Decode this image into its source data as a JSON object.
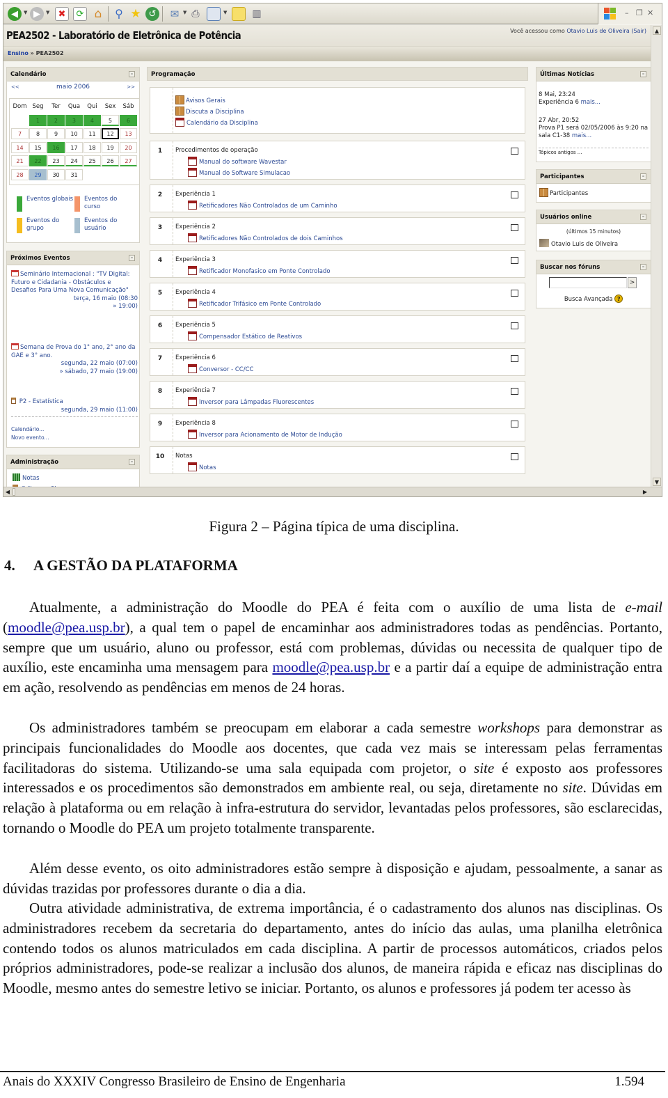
{
  "browser": {
    "toolbar_icons": [
      "back-icon",
      "forward-icon",
      "stop-icon",
      "refresh-icon",
      "home-icon",
      "search-icon",
      "favorites-icon",
      "history-icon",
      "mail-icon",
      "print-icon",
      "edit-icon",
      "notes-icon",
      "research-icon"
    ],
    "window_controls": [
      "minimize",
      "restore",
      "close"
    ]
  },
  "moodle": {
    "site_title": "PEA2502 - Laboratório de Eletrônica de Potência",
    "login": {
      "prefix": "Você acessou como",
      "user": "Otavio Luis de Oliveira",
      "logout": "(Sair)"
    },
    "breadcrumb": {
      "root": "Ensino",
      "sep": "»",
      "current": "PEA2502"
    },
    "calendar": {
      "title": "Calendário",
      "prev": "<<",
      "month": "maio 2006",
      "next": ">>",
      "weekdays": [
        "Dom",
        "Seg",
        "Ter",
        "Qua",
        "Qui",
        "Sex",
        "Sáb"
      ],
      "weeks": [
        [
          "",
          "1",
          "2",
          "3",
          "4",
          "5",
          "6"
        ],
        [
          "7",
          "8",
          "9",
          "10",
          "11",
          "12",
          "13"
        ],
        [
          "14",
          "15",
          "16",
          "17",
          "18",
          "19",
          "20"
        ],
        [
          "21",
          "22",
          "23",
          "24",
          "25",
          "26",
          "27"
        ],
        [
          "28",
          "29",
          "30",
          "31",
          "",
          "",
          ""
        ]
      ],
      "today": "12",
      "global_event_days": [
        "1",
        "2",
        "3",
        "4",
        "6",
        "16",
        "22"
      ],
      "underlined_days": [
        "5",
        "23",
        "24",
        "25",
        "26",
        "27"
      ],
      "user_event_days": [
        "29"
      ],
      "legend": [
        {
          "label": "Eventos globais",
          "color": "#3aa83a"
        },
        {
          "label": "Eventos do curso",
          "color": "#f4956a"
        },
        {
          "label": "Eventos do grupo",
          "color": "#f5bd1f"
        },
        {
          "label": "Eventos do usuário",
          "color": "#a7bfcf"
        }
      ]
    },
    "upcoming": {
      "title": "Próximos Eventos",
      "events": [
        {
          "name": "Seminário Internacional : \"TV Digital: Futuro e Cidadania - Obstáculos e Desafios Para Uma Nova Comunicação\"",
          "start": "terça, 16 maio (08:30",
          "end": "» 19:00)"
        },
        {
          "name": "Semana de Prova do 1° ano, 2° ano da GAE e 3° ano.",
          "start": "segunda, 22 maio (07:00)",
          "end": "» sábado, 27 maio (19:00)"
        },
        {
          "name": "P2 - Estatística",
          "start": "segunda, 29 maio (11:00)",
          "end": ""
        }
      ],
      "links": [
        "Calendário...",
        "Novo evento..."
      ]
    },
    "admin": {
      "title": "Administração",
      "items": [
        "Notas",
        "Editar perfil"
      ]
    },
    "programacao": {
      "title": "Programação",
      "intro": [
        {
          "icon": "forum",
          "label": "Avisos Gerais"
        },
        {
          "icon": "forum",
          "label": "Discuta a Disciplina"
        },
        {
          "icon": "pdf",
          "label": "Calendário da Disciplina"
        }
      ],
      "sections": [
        {
          "num": "1",
          "title": "Procedimentos de operação",
          "resources": [
            "Manual do software Wavestar",
            "Manual do Software Simulacao"
          ]
        },
        {
          "num": "2",
          "title": "Experiência 1",
          "resources": [
            "Retificadores Não Controlados de um Caminho"
          ]
        },
        {
          "num": "3",
          "title": "Experiência 2",
          "resources": [
            "Retificadores Não Controlados de dois Caminhos"
          ]
        },
        {
          "num": "4",
          "title": "Experiência 3",
          "resources": [
            "Retificador Monofasico em Ponte Controlado"
          ]
        },
        {
          "num": "5",
          "title": "Experiência 4",
          "resources": [
            "Retificador Trifásico em Ponte Controlado"
          ]
        },
        {
          "num": "6",
          "title": "Experiência 5",
          "resources": [
            "Compensador Estático de Reativos"
          ]
        },
        {
          "num": "7",
          "title": "Experiência 6",
          "resources": [
            "Conversor - CC/CC"
          ]
        },
        {
          "num": "8",
          "title": "Experiência 7",
          "resources": [
            "Inversor para Lâmpadas Fluorescentes"
          ]
        },
        {
          "num": "9",
          "title": "Experiência 8",
          "resources": [
            "Inversor para Acionamento de Motor de Indução"
          ]
        },
        {
          "num": "10",
          "title": "Notas",
          "resources": [
            "Notas"
          ]
        }
      ]
    },
    "news": {
      "title": "Últimas Notícias",
      "items": [
        {
          "date": "8 Mai, 23:24",
          "text": "Experiência 6",
          "more": "mais..."
        },
        {
          "date": "27 Abr, 20:52",
          "text": "Prova P1 será 02/05/2006 às 9:20 na sala C1-38",
          "more": "mais..."
        }
      ],
      "older": "Tópicos antigos ..."
    },
    "participants": {
      "title": "Participantes",
      "link": "Participantes"
    },
    "online": {
      "title": "Usuários online",
      "subtitle": "(últimos 15 minutos)",
      "users": [
        "Otavio Luis de Oliveira"
      ]
    },
    "forum_search": {
      "title": "Buscar nos fóruns",
      "value": "",
      "go": ">",
      "advanced": "Busca Avançada",
      "help": "?"
    }
  },
  "document": {
    "caption": "Figura 2 – Página típica de uma disciplina.",
    "section_number": "4.",
    "section_title": "A GESTÃO DA PLATAFORMA",
    "p1": {
      "a": "Atualmente, a administração do Moodle do PEA é feita com o auxílio de uma lista de ",
      "em": "e-mail",
      "b": " (",
      "link1": "moodle@pea.usp.br",
      "c": "), a qual tem o papel de encaminhar aos administradores todas as pendências. Portanto, sempre que um usuário, aluno ou professor, está com problemas, dúvidas ou necessita de qualquer tipo de auxílio, este encaminha uma mensagem para ",
      "link2": "moodle@pea.usp.br",
      "d": " e a partir daí a equipe de administração entra em ação, resolvendo as pendências em menos de 24 horas."
    },
    "p2": {
      "a": "Os administradores também se preocupam em elaborar a cada semestre ",
      "em1": "workshops",
      "b": " para demonstrar as principais funcionalidades do Moodle aos docentes, que cada vez mais se interessam pelas ferramentas facilitadoras do sistema. Utilizando-se uma sala equipada com projetor, o ",
      "em2": "site",
      "c": " é exposto aos professores interessados e os procedimentos são demonstrados em ambiente real, ou seja, diretamente no ",
      "em3": "site",
      "d": ". Dúvidas em relação à plataforma ou em relação à infra-estrutura do servidor, levantadas pelos professores, são esclarecidas, tornando o Moodle do PEA um projeto totalmente transparente."
    },
    "p3": "Além desse evento, os oito administradores estão sempre à disposição e ajudam, pessoalmente, a sanar as dúvidas trazidas por professores durante o dia a dia.",
    "p4": "Outra atividade administrativa, de extrema importância, é o cadastramento dos alunos nas disciplinas. Os administradores recebem da secretaria do departamento, antes do início das aulas, uma planilha eletrônica contendo todos os alunos matriculados em cada disciplina. A partir de processos automáticos, criados pelos próprios administradores, pode-se realizar a inclusão dos alunos, de maneira rápida e eficaz nas disciplinas do Moodle, mesmo antes do semestre letivo se iniciar. Portanto, os alunos e professores já podem ter acesso às",
    "footer_left": "Anais do XXXIV Congresso Brasileiro de Ensino de Engenharia",
    "footer_right": "1.594"
  }
}
